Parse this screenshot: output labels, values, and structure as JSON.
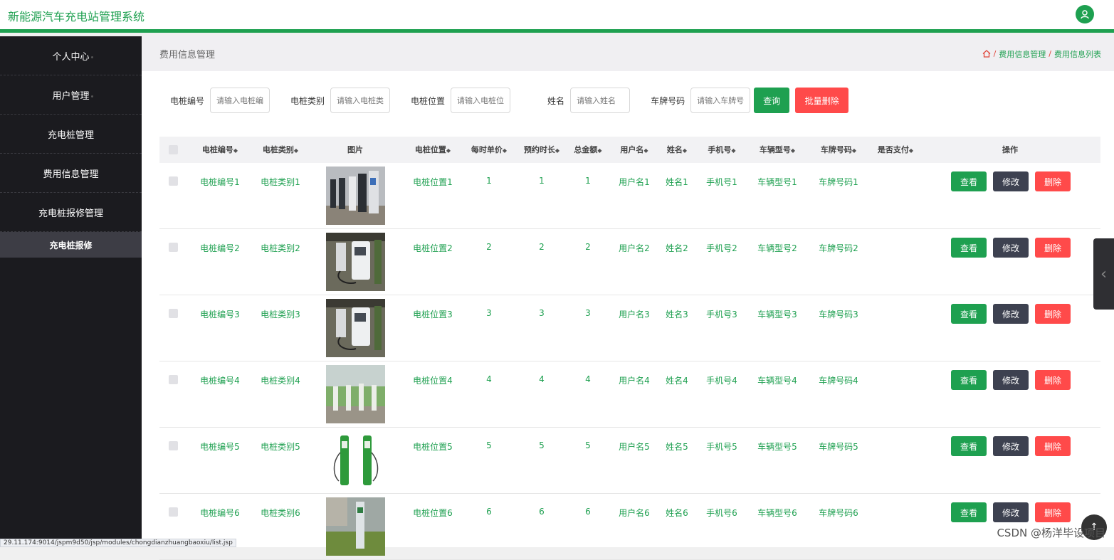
{
  "app": {
    "title": "新能源汽车充电站管理系统",
    "avatar_icon": "user-icon",
    "accent": "#1ea050"
  },
  "sidebar": {
    "items": [
      {
        "label": "个人中心"
      },
      {
        "label": "用户管理"
      },
      {
        "label": "充电桩管理"
      },
      {
        "label": "费用信息管理"
      },
      {
        "label": "充电桩报修管理"
      }
    ],
    "sub_item": "充电桩报修"
  },
  "header": {
    "title": "费用信息管理",
    "breadcrumb": [
      "费用信息管理",
      "费用信息列表"
    ],
    "home_icon": "home-icon"
  },
  "search": {
    "fields": [
      {
        "label": "电桩编号",
        "placeholder": "请输入电桩编号"
      },
      {
        "label": "电桩类别",
        "placeholder": "请输入电桩类别"
      },
      {
        "label": "电桩位置",
        "placeholder": "请输入电桩位置"
      },
      {
        "label": "姓名",
        "placeholder": "请输入姓名"
      },
      {
        "label": "车牌号码",
        "placeholder": "请输入车牌号码"
      }
    ],
    "query_label": "查询",
    "batch_delete_label": "批量删除"
  },
  "table": {
    "columns": [
      "电桩编号",
      "电桩类别",
      "图片",
      "电桩位置",
      "每时单价",
      "预约时长",
      "总金额",
      "用户名",
      "姓名",
      "手机号",
      "车辆型号",
      "车牌号码",
      "是否支付",
      "操作"
    ],
    "sort_glyph": "◆",
    "rows": [
      [
        "电桩编号1",
        "电桩类别1",
        "电桩位置1",
        "1",
        "1",
        "1",
        "用户名1",
        "姓名1",
        "手机号1",
        "车辆型号1",
        "车牌号码1"
      ],
      [
        "电桩编号2",
        "电桩类别2",
        "电桩位置2",
        "2",
        "2",
        "2",
        "用户名2",
        "姓名2",
        "手机号2",
        "车辆型号2",
        "车牌号码2"
      ],
      [
        "电桩编号3",
        "电桩类别3",
        "电桩位置3",
        "3",
        "3",
        "3",
        "用户名3",
        "姓名3",
        "手机号3",
        "车辆型号3",
        "车牌号码3"
      ],
      [
        "电桩编号4",
        "电桩类别4",
        "电桩位置4",
        "4",
        "4",
        "4",
        "用户名4",
        "姓名4",
        "手机号4",
        "车辆型号4",
        "车牌号码4"
      ],
      [
        "电桩编号5",
        "电桩类别5",
        "电桩位置5",
        "5",
        "5",
        "5",
        "用户名5",
        "姓名5",
        "手机号5",
        "车辆型号5",
        "车牌号码5"
      ],
      [
        "电桩编号6",
        "电桩类别6",
        "电桩位置6",
        "6",
        "6",
        "6",
        "用户名6",
        "姓名6",
        "手机号6",
        "车辆型号6",
        "车牌号码6"
      ]
    ],
    "actions": {
      "view": "查看",
      "edit": "修改",
      "delete": "删除"
    }
  },
  "status_url": "29.11.174:9014/jspm9d50/jsp/modules/chongdianzhuangbaoxiu/list.jsp",
  "watermark": "CSDN @杨洋毕设项目"
}
